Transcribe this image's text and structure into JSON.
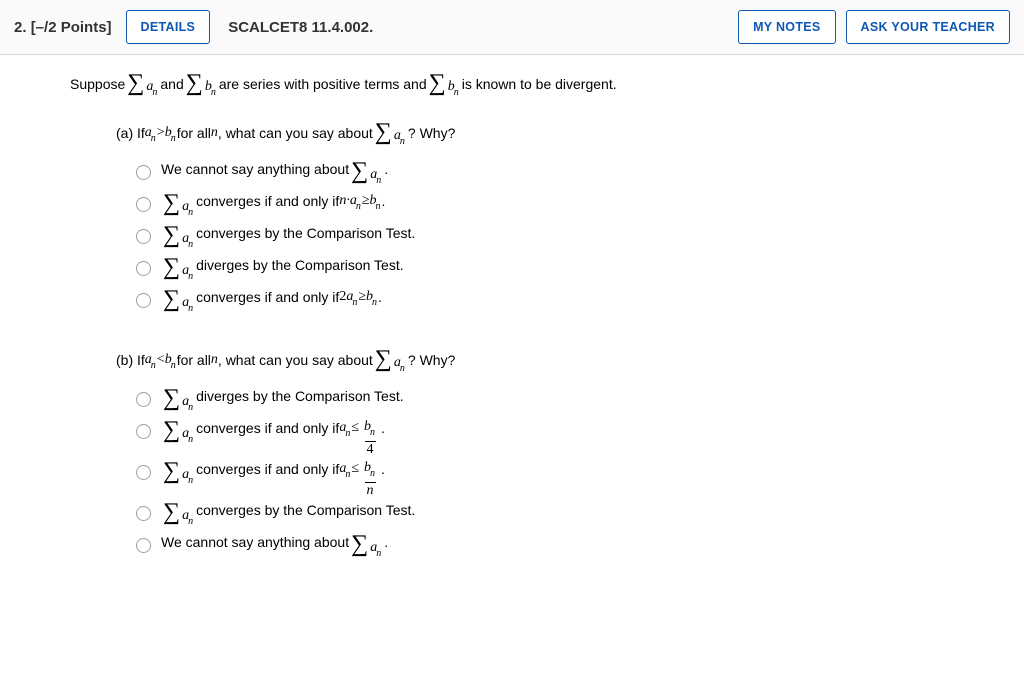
{
  "header": {
    "question_number": "2.",
    "points": "[–/2 Points]",
    "details_btn": "DETAILS",
    "reference": "SCALCET8 11.4.002.",
    "my_notes_btn": "MY NOTES",
    "ask_teacher_btn": "ASK YOUR TEACHER"
  },
  "prompt": {
    "t1": "Suppose ",
    "t2": " and ",
    "t3": " are series with positive terms and ",
    "t4": " is known to be divergent."
  },
  "part_a": {
    "label": "(a) If ",
    "cond1": "a",
    "rel": " > ",
    "cond2": "b",
    "mid": " for all ",
    "nvar": "n",
    "mid2": ", what can you say about ",
    "tail": "? Why?",
    "options": [
      {
        "pre": "We cannot say anything about ",
        "sum": "an",
        "post": "."
      },
      {
        "sum": "an",
        "post_pre": " converges if and only if ",
        "math": "n·a",
        "math_sub": "n",
        "rel": " ≥ ",
        "rhs": "b",
        "rhs_sub": "n",
        "post": "."
      },
      {
        "sum": "an",
        "post": " converges by the Comparison Test."
      },
      {
        "sum": "an",
        "post": " diverges by the Comparison Test."
      },
      {
        "sum": "an",
        "post_pre": " converges if and only if ",
        "math": "2a",
        "math_sub": "n",
        "rel": " ≥ ",
        "rhs": "b",
        "rhs_sub": "n",
        "post": "."
      }
    ]
  },
  "part_b": {
    "label": "(b) If ",
    "cond1": "a",
    "rel": " < ",
    "cond2": "b",
    "mid": " for all ",
    "nvar": "n",
    "mid2": ", what can you say about ",
    "tail": "? Why?",
    "options": [
      {
        "sum": "an",
        "post": " diverges by the Comparison Test."
      },
      {
        "sum": "an",
        "post_pre": " converges if and only if ",
        "math": "a",
        "math_sub": "n",
        "rel": " ≤ ",
        "frac_num": "b",
        "frac_num_sub": "n",
        "frac_den": "4",
        "post": "."
      },
      {
        "sum": "an",
        "post_pre": " converges if and only if ",
        "math": "a",
        "math_sub": "n",
        "rel": " ≤ ",
        "frac_num": "b",
        "frac_num_sub": "n",
        "frac_den": "n",
        "post": "."
      },
      {
        "sum": "an",
        "post": " converges by the Comparison Test."
      },
      {
        "pre": "We cannot say anything about ",
        "sum": "an",
        "post": "."
      }
    ]
  },
  "sym": {
    "sigma": "∑",
    "a": "a",
    "b": "b",
    "n": "n"
  }
}
